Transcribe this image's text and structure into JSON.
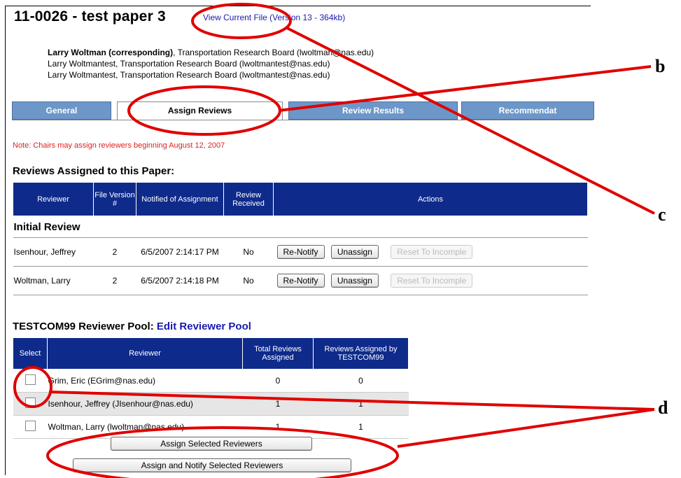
{
  "paper": {
    "title": "11-0026 - test paper 3",
    "file_link": "View Current File (Version 13 - 364kb)",
    "authors": [
      {
        "name": "Larry Woltman (corresponding)",
        "rest": ", Transportation Research Board (lwoltman@nas.edu)"
      },
      {
        "name": "",
        "rest": "Larry Woltmantest, Transportation Research Board (lwoltmantest@nas.edu)"
      },
      {
        "name": "",
        "rest": "Larry Woltmantest, Transportation Research Board (lwoltmantest@nas.edu)"
      }
    ]
  },
  "tabs": [
    "General",
    "Assign Reviews",
    "Review Results",
    "Recommendat"
  ],
  "note": "Note: Chairs may assign reviewers beginning August 12, 2007",
  "reviews": {
    "title": "Reviews Assigned to this Paper:",
    "headers": [
      "Reviewer",
      "File Version #",
      "Notified of Assignment",
      "Review Received",
      "Actions"
    ],
    "group": "Initial Review",
    "rows": [
      {
        "reviewer": "Isenhour, Jeffrey",
        "version": "2",
        "notified": "6/5/2007 2:14:17 PM",
        "received": "No"
      },
      {
        "reviewer": "Woltman, Larry",
        "version": "2",
        "notified": "6/5/2007 2:14:18 PM",
        "received": "No"
      }
    ],
    "btn_renotify": "Re-Notify",
    "btn_unassign": "Unassign",
    "btn_reset": "Reset To Incomple"
  },
  "pool": {
    "title": "TESTCOM99 Reviewer Pool:",
    "edit_link": "Edit Reviewer Pool",
    "headers": [
      "Select",
      "Reviewer",
      "Total Reviews Assigned",
      "Reviews Assigned by TESTCOM99"
    ],
    "rows": [
      {
        "reviewer": "Grim, Eric (EGrim@nas.edu)",
        "total": "0",
        "by_com": "0"
      },
      {
        "reviewer": "Isenhour, Jeffrey (JIsenhour@nas.edu)",
        "total": "1",
        "by_com": "1"
      },
      {
        "reviewer": "Woltman, Larry (lwoltman@nas.edu)",
        "total": "1",
        "by_com": "1"
      }
    ],
    "btn_assign": "Assign Selected Reviewers",
    "btn_assign_notify": "Assign and Notify Selected Reviewers"
  },
  "callouts": [
    "b",
    "c",
    "d"
  ],
  "colors": {
    "header_blue": "#0e2a8a",
    "tab_blue": "#6d97c8",
    "callout_red": "#e00000",
    "note_red": "#e02020"
  }
}
